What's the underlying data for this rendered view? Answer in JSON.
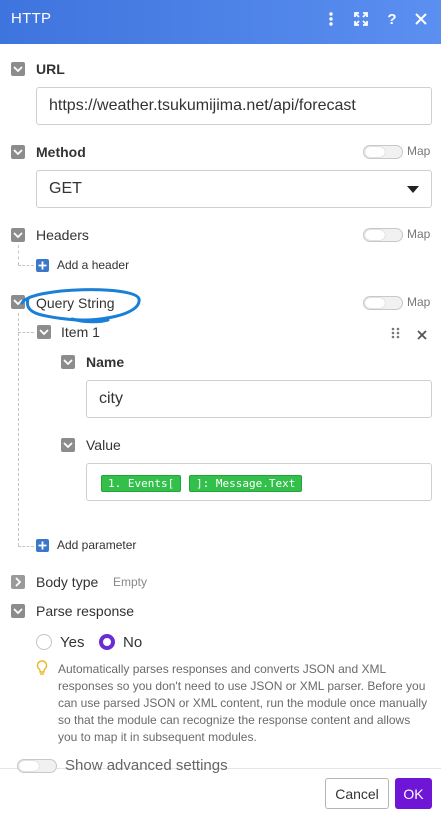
{
  "header": {
    "title": "HTTP",
    "accent": "#4a80e6"
  },
  "fields": {
    "url": {
      "label": "URL",
      "value": "https://weather.tsukumijima.net/api/forecast"
    },
    "method": {
      "label": "Method",
      "value": "GET",
      "map_label": "Map"
    },
    "headers": {
      "label": "Headers",
      "map_label": "Map",
      "add_label": "Add a header"
    },
    "query_string": {
      "label": "Query String",
      "map_label": "Map",
      "item": {
        "label": "Item 1",
        "name_label": "Name",
        "name_value": "city",
        "value_label": "Value",
        "pills": [
          "1. Events[",
          "]: Message.Text"
        ]
      },
      "add_label": "Add parameter"
    },
    "body_type": {
      "label": "Body type",
      "value": "Empty"
    },
    "parse_response": {
      "label": "Parse response",
      "options": [
        "Yes",
        "No"
      ],
      "selected": "No",
      "note": "Automatically parses responses and converts JSON and XML responses so you don't need to use JSON or XML parser. Before you can use parsed JSON or XML content, run the module once manually so that the module can recognize the response content and allows you to map it in subsequent modules."
    }
  },
  "footer": {
    "advanced_label": "Show advanced settings",
    "cancel_label": "Cancel",
    "ok_label": "OK"
  },
  "colors": {
    "primary": "#6f16d6",
    "pill": "#33c04a",
    "annotation": "#1a7fd6"
  }
}
